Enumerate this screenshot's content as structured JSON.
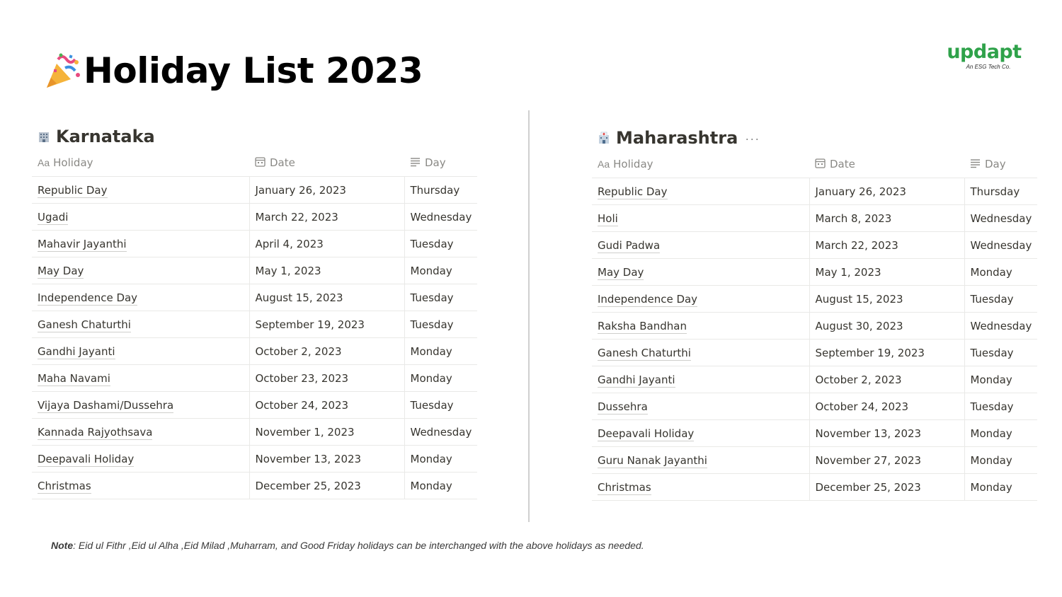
{
  "page": {
    "title": "Holiday List 2023",
    "title_icon": "party-popper-icon"
  },
  "logo": {
    "word": "updapt",
    "tagline": "An ESG Tech Co.",
    "color": "#2fa24a"
  },
  "columns": {
    "holiday": "Holiday",
    "holiday_prefix": "Aa",
    "date": "Date",
    "day": "Day"
  },
  "karnataka": {
    "title": "Karnataka",
    "icon": "office-building-icon",
    "rows": [
      {
        "holiday": "Republic Day",
        "date": "January 26, 2023",
        "day": "Thursday"
      },
      {
        "holiday": "Ugadi",
        "date": "March 22, 2023",
        "day": "Wednesday"
      },
      {
        "holiday": "Mahavir Jayanthi",
        "date": "April 4, 2023",
        "day": "Tuesday"
      },
      {
        "holiday": "May Day",
        "date": "May 1, 2023",
        "day": "Monday"
      },
      {
        "holiday": "Independence Day",
        "date": "August 15, 2023",
        "day": "Tuesday"
      },
      {
        "holiday": "Ganesh Chaturthi",
        "date": "September 19, 2023",
        "day": "Tuesday"
      },
      {
        "holiday": "Gandhi Jayanti",
        "date": "October 2, 2023",
        "day": "Monday"
      },
      {
        "holiday": "Maha Navami",
        "date": "October 23, 2023",
        "day": "Monday"
      },
      {
        "holiday": "Vijaya Dashami/Dussehra",
        "date": "October 24, 2023",
        "day": "Tuesday"
      },
      {
        "holiday": "Kannada Rajyothsava",
        "date": "November 1, 2023",
        "day": "Wednesday"
      },
      {
        "holiday": "Deepavali Holiday",
        "date": "November 13, 2023",
        "day": "Monday"
      },
      {
        "holiday": "Christmas",
        "date": "December 25, 2023",
        "day": "Monday"
      }
    ]
  },
  "maharashtra": {
    "title": "Maharashtra",
    "icon": "hospital-building-icon",
    "more": "···",
    "rows": [
      {
        "holiday": "Republic Day",
        "date": "January 26, 2023",
        "day": "Thursday"
      },
      {
        "holiday": "Holi",
        "date": "March 8, 2023",
        "day": "Wednesday"
      },
      {
        "holiday": "Gudi Padwa",
        "date": "March 22, 2023",
        "day": "Wednesday"
      },
      {
        "holiday": "May Day",
        "date": "May 1, 2023",
        "day": "Monday"
      },
      {
        "holiday": "Independence Day",
        "date": "August 15, 2023",
        "day": "Tuesday"
      },
      {
        "holiday": "Raksha Bandhan",
        "date": "August 30, 2023",
        "day": "Wednesday"
      },
      {
        "holiday": "Ganesh Chaturthi",
        "date": "September 19, 2023",
        "day": "Tuesday"
      },
      {
        "holiday": "Gandhi Jayanti",
        "date": "October 2, 2023",
        "day": "Monday"
      },
      {
        "holiday": "Dussehra",
        "date": "October 24, 2023",
        "day": "Tuesday"
      },
      {
        "holiday": "Deepavali Holiday",
        "date": "November 13, 2023",
        "day": "Monday"
      },
      {
        "holiday": "Guru Nanak Jayanthi",
        "date": "November 27, 2023",
        "day": "Monday"
      },
      {
        "holiday": "Christmas",
        "date": "December 25, 2023",
        "day": "Monday"
      }
    ]
  },
  "note": {
    "label": "Note",
    "text": ": Eid ul Fithr ,Eid ul Alha ,Eid Milad ,Muharram, and Good Friday holidays can be interchanged with the above holidays as needed."
  }
}
